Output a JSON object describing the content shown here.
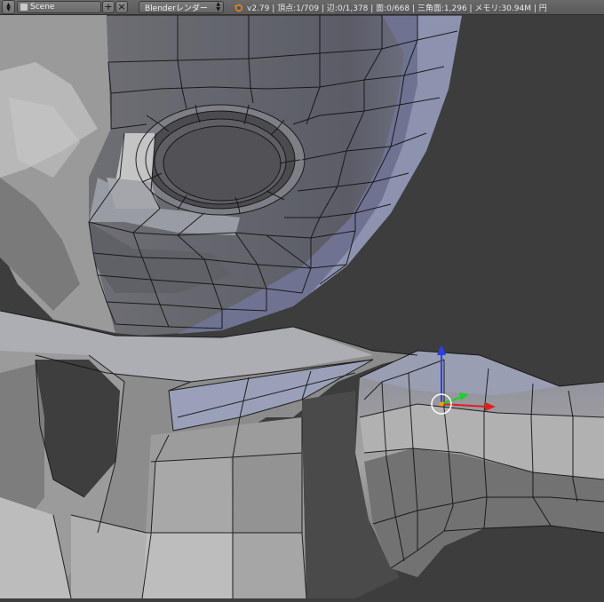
{
  "header": {
    "scene_label": "Scene",
    "add_scene_symbol": "+",
    "remove_scene_symbol": "×",
    "render_engine": "Blenderレンダー",
    "stats": "v2.79 | 頂点:1/709 | 辺:0/1,378 | 面:0/668 | 三角面:1,296 | メモリ:30.94M | 円"
  },
  "icons": {
    "screen_spinner": "up-down-arrows-icon",
    "scene_icon": "scene-icon",
    "blender_logo": "blender-logo-icon",
    "engine_spinner": "up-down-arrows-icon"
  },
  "colors": {
    "viewport_bg": "#3d3d3d",
    "header_bg": "#626262",
    "gizmo_x": "#e0201e",
    "gizmo_y": "#1fcf2a",
    "gizmo_z": "#2a3fe8",
    "pivot_ring": "#ffffff",
    "selected_vertex": "#f3a020"
  }
}
